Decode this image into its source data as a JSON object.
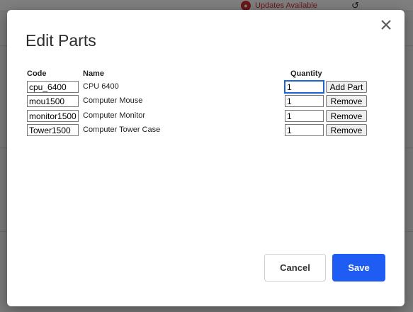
{
  "background": {
    "updates_label": "Updates Available"
  },
  "modal": {
    "title": "Edit Parts",
    "columns": {
      "code": "Code",
      "name": "Name",
      "quantity": "Quantity"
    },
    "rows": [
      {
        "code": "cpu_6400",
        "name": "CPU 6400",
        "quantity": "1",
        "action": "Add Part"
      },
      {
        "code": "mou1500",
        "name": "Computer Mouse",
        "quantity": "1",
        "action": "Remove"
      },
      {
        "code": "monitor1500",
        "name": "Computer Monitor",
        "quantity": "1",
        "action": "Remove"
      },
      {
        "code": "Tower1500",
        "name": "Computer Tower Case",
        "quantity": "1",
        "action": "Remove"
      }
    ],
    "cancel_label": "Cancel",
    "save_label": "Save"
  },
  "colors": {
    "primary": "#1f5cf3",
    "alert": "#d32f2f"
  }
}
